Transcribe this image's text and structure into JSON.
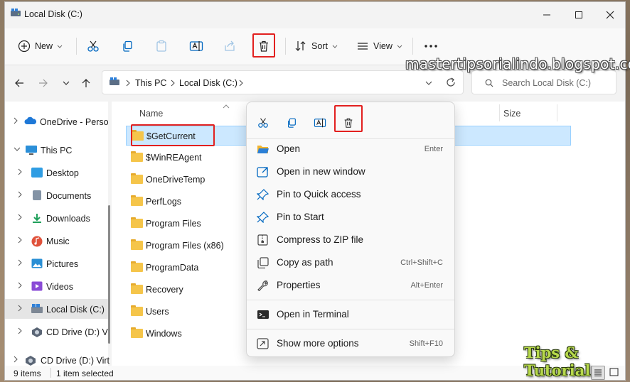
{
  "window": {
    "title": "Local Disk (C:)"
  },
  "toolbar": {
    "new_label": "New",
    "sort_label": "Sort",
    "view_label": "View"
  },
  "address": {
    "crumbs": [
      "This PC",
      "Local Disk (C:)"
    ],
    "search_placeholder": "Search Local Disk (C:)"
  },
  "nav": {
    "items": [
      {
        "label": "OneDrive - Perso",
        "icon": "cloud-icon",
        "color": "#1e78d7"
      },
      {
        "label": "This PC",
        "icon": "monitor-icon",
        "color": "#2b8fd8",
        "expanded": true
      },
      {
        "label": "Desktop",
        "icon": "desktop-icon",
        "color": "#2f9de3"
      },
      {
        "label": "Documents",
        "icon": "documents-icon",
        "color": "#6c7b8b"
      },
      {
        "label": "Downloads",
        "icon": "download-icon",
        "color": "#1fa05b"
      },
      {
        "label": "Music",
        "icon": "music-icon",
        "color": "#e0523b"
      },
      {
        "label": "Pictures",
        "icon": "pictures-icon",
        "color": "#2a8fd5"
      },
      {
        "label": "Videos",
        "icon": "videos-icon",
        "color": "#8a4bd6"
      },
      {
        "label": "Local Disk (C:)",
        "icon": "drive-icon",
        "color": "#7d8794",
        "selected": true
      },
      {
        "label": "CD Drive (D:) Vi",
        "icon": "cd-drive-icon",
        "color": "#5a6575"
      },
      {
        "label": "CD Drive (D:) Virt",
        "icon": "cd-drive-icon",
        "color": "#5a6575"
      }
    ]
  },
  "files": {
    "col_name": "Name",
    "col_size": "Size",
    "items": [
      "$GetCurrent",
      "$WinREAgent",
      "OneDriveTemp",
      "PerfLogs",
      "Program Files",
      "Program Files (x86)",
      "ProgramData",
      "Recovery",
      "Users",
      "Windows"
    ]
  },
  "status": {
    "count": "9 items",
    "selected": "1 item selected"
  },
  "context_menu": {
    "items": [
      {
        "label": "Open",
        "shortcut": "Enter",
        "icon": "open-folder-icon"
      },
      {
        "label": "Open in new window",
        "shortcut": "",
        "icon": "new-window-icon"
      },
      {
        "label": "Pin to Quick access",
        "shortcut": "",
        "icon": "pin-icon"
      },
      {
        "label": "Pin to Start",
        "shortcut": "",
        "icon": "pin-icon"
      },
      {
        "label": "Compress to ZIP file",
        "shortcut": "",
        "icon": "zip-icon"
      },
      {
        "label": "Copy as path",
        "shortcut": "Ctrl+Shift+C",
        "icon": "copy-path-icon"
      },
      {
        "label": "Properties",
        "shortcut": "Alt+Enter",
        "icon": "wrench-icon"
      },
      {
        "label": "Open in Terminal",
        "shortcut": "",
        "icon": "terminal-icon"
      },
      {
        "label": "Show more options",
        "shortcut": "Shift+F10",
        "icon": "more-options-icon"
      }
    ]
  },
  "watermarks": {
    "site": "mastertipsorialindo.blogspot.com",
    "brand": "Tips & Tutorial"
  },
  "colors": {
    "highlight_box": "#e2201f",
    "selection": "#cce8ff",
    "accent": "#0067c0"
  }
}
